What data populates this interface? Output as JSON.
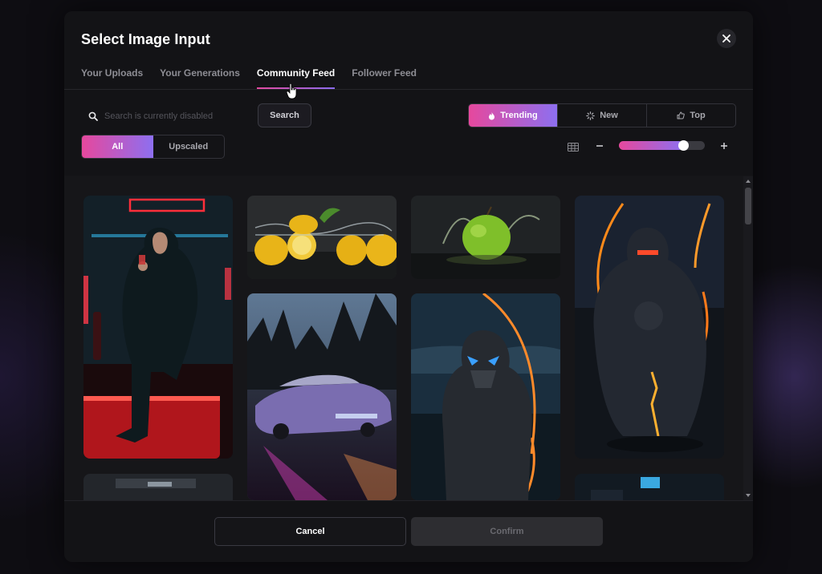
{
  "modal": {
    "title": "Select Image Input",
    "close_icon": "close-icon"
  },
  "tabs": [
    {
      "label": "Your Uploads",
      "active": false
    },
    {
      "label": "Your Generations",
      "active": false
    },
    {
      "label": "Community Feed",
      "active": true
    },
    {
      "label": "Follower Feed",
      "active": false
    }
  ],
  "search": {
    "placeholder": "Search is currently disabled",
    "value": "",
    "button_label": "Search",
    "icon": "search-icon"
  },
  "sort": [
    {
      "label": "Trending",
      "icon": "flame-icon",
      "active": true
    },
    {
      "label": "New",
      "icon": "loader-icon",
      "active": false
    },
    {
      "label": "Top",
      "icon": "thumbs-up-icon",
      "active": false
    }
  ],
  "filter": [
    {
      "label": "All",
      "active": true
    },
    {
      "label": "Upscaled",
      "active": false
    }
  ],
  "zoom": {
    "grid_icon": "grid-icon",
    "minus_icon": "minus-icon",
    "plus_icon": "plus-icon",
    "level": 0.75
  },
  "gallery": {
    "images": [
      {
        "subject": "man-in-suit-neon-bar"
      },
      {
        "subject": "lemons-water-splash"
      },
      {
        "subject": "green-apple-splash"
      },
      {
        "subject": "hooded-archer-fire"
      },
      {
        "subject": "futuristic-car-neon-road"
      },
      {
        "subject": "ninja-archer-blue-eyes"
      },
      {
        "subject": "dark-corridor-partial"
      },
      {
        "subject": "blue-light-room-partial"
      }
    ]
  },
  "footer": {
    "cancel_label": "Cancel",
    "confirm_label": "Confirm"
  },
  "colors": {
    "accent_start": "#e6489d",
    "accent_end": "#8d6ff0",
    "modal_bg": "#131316"
  }
}
